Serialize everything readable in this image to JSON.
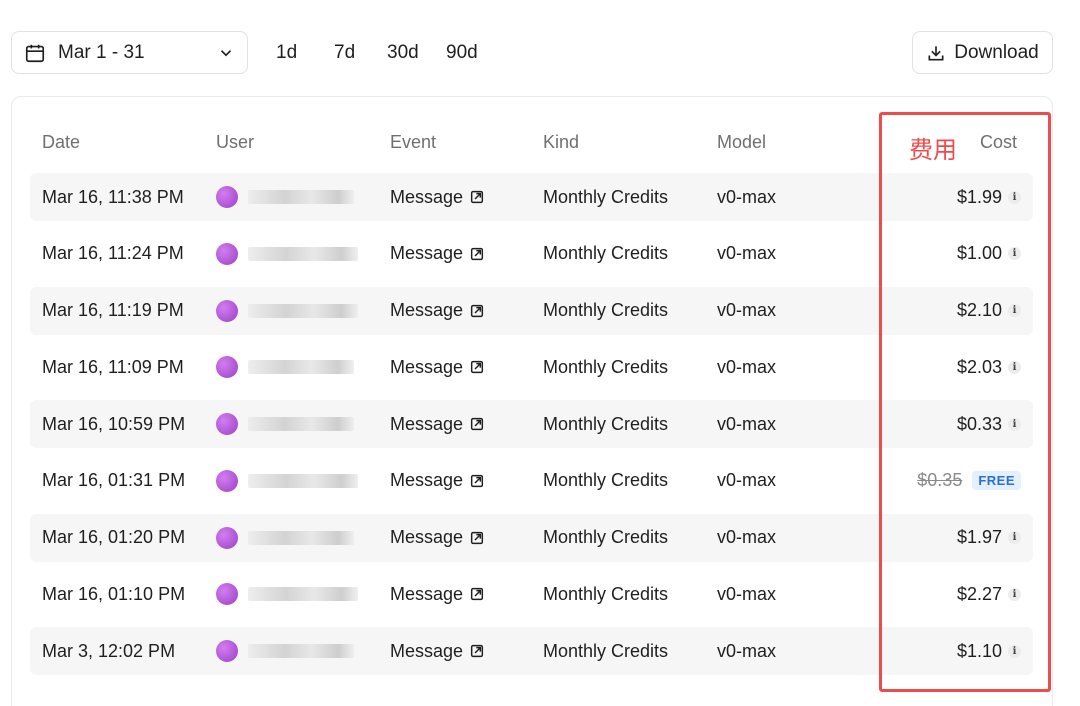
{
  "toolbar": {
    "date_range": "Mar 1 - 31",
    "presets": [
      "1d",
      "7d",
      "30d",
      "90d"
    ],
    "download_label": "Download"
  },
  "table": {
    "headers": {
      "date": "Date",
      "user": "User",
      "event": "Event",
      "kind": "Kind",
      "model": "Model",
      "cost": "Cost"
    },
    "rows": [
      {
        "date": "Mar 16, 11:38 PM",
        "event": "Message",
        "kind": "Monthly Credits",
        "model": "v0-max",
        "cost": "$1.99"
      },
      {
        "date": "Mar 16, 11:24 PM",
        "event": "Message",
        "kind": "Monthly Credits",
        "model": "v0-max",
        "cost": "$1.00"
      },
      {
        "date": "Mar 16, 11:19 PM",
        "event": "Message",
        "kind": "Monthly Credits",
        "model": "v0-max",
        "cost": "$2.10"
      },
      {
        "date": "Mar 16, 11:09 PM",
        "event": "Message",
        "kind": "Monthly Credits",
        "model": "v0-max",
        "cost": "$2.03"
      },
      {
        "date": "Mar 16, 10:59 PM",
        "event": "Message",
        "kind": "Monthly Credits",
        "model": "v0-max",
        "cost": "$0.33"
      },
      {
        "date": "Mar 16, 01:31 PM",
        "event": "Message",
        "kind": "Monthly Credits",
        "model": "v0-max",
        "cost": "$0.35",
        "badge": "FREE"
      },
      {
        "date": "Mar 16, 01:20 PM",
        "event": "Message",
        "kind": "Monthly Credits",
        "model": "v0-max",
        "cost": "$1.97"
      },
      {
        "date": "Mar 16, 01:10 PM",
        "event": "Message",
        "kind": "Monthly Credits",
        "model": "v0-max",
        "cost": "$2.27"
      },
      {
        "date": "Mar 3, 12:02 PM",
        "event": "Message",
        "kind": "Monthly Credits",
        "model": "v0-max",
        "cost": "$1.10"
      }
    ]
  },
  "annotation": {
    "label": "费用",
    "color": "#ef4b4b"
  },
  "icons": {
    "calendar": "calendar-icon",
    "chevron": "chevron-down-icon",
    "download": "download-icon",
    "external": "external-link-icon",
    "info": "info-icon",
    "avatar": "avatar"
  }
}
